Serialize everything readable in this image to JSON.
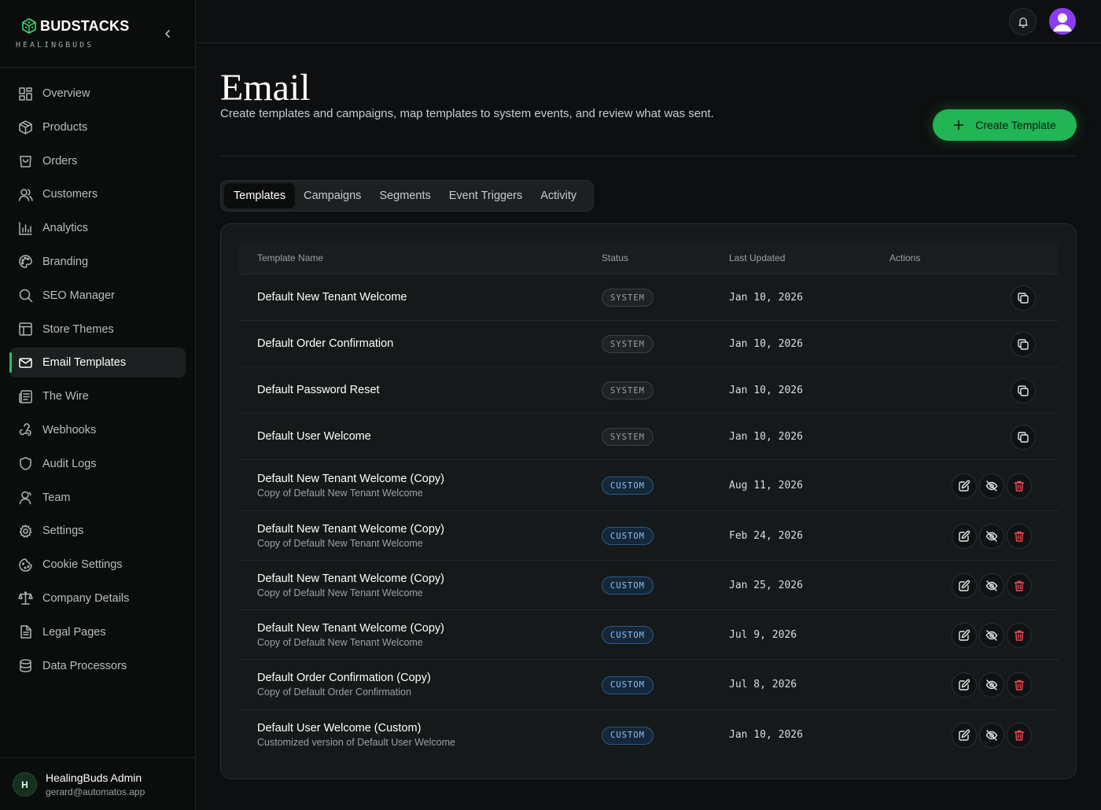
{
  "brand": {
    "name": "BUDSTACKS",
    "tagline": "HEALINGBUDS"
  },
  "sidebar": {
    "items": [
      {
        "label": "Overview",
        "icon": "grid-icon"
      },
      {
        "label": "Products",
        "icon": "box-icon"
      },
      {
        "label": "Orders",
        "icon": "bag-icon"
      },
      {
        "label": "Customers",
        "icon": "users-icon"
      },
      {
        "label": "Analytics",
        "icon": "bar-chart-icon"
      },
      {
        "label": "Branding",
        "icon": "palette-icon"
      },
      {
        "label": "SEO Manager",
        "icon": "search-icon"
      },
      {
        "label": "Store Themes",
        "icon": "layout-icon"
      },
      {
        "label": "Email Templates",
        "icon": "mail-icon",
        "active": true
      },
      {
        "label": "The Wire",
        "icon": "newspaper-icon"
      },
      {
        "label": "Webhooks",
        "icon": "webhook-icon"
      },
      {
        "label": "Audit Logs",
        "icon": "shield-icon"
      },
      {
        "label": "Team",
        "icon": "user-icon"
      },
      {
        "label": "Settings",
        "icon": "gear-icon"
      },
      {
        "label": "Cookie Settings",
        "icon": "cookie-icon"
      },
      {
        "label": "Company Details",
        "icon": "scale-icon"
      },
      {
        "label": "Legal Pages",
        "icon": "document-icon"
      },
      {
        "label": "Data Processors",
        "icon": "database-icon"
      }
    ]
  },
  "user": {
    "initial": "H",
    "name": "HealingBuds Admin",
    "email": "gerard@automatos.app"
  },
  "page": {
    "title": "Email",
    "description": "Create templates and campaigns, map templates to system events, and review what was sent.",
    "create_label": "Create Template"
  },
  "tabs": [
    {
      "label": "Templates",
      "active": true
    },
    {
      "label": "Campaigns"
    },
    {
      "label": "Segments"
    },
    {
      "label": "Event Triggers"
    },
    {
      "label": "Activity"
    }
  ],
  "table": {
    "headers": {
      "name": "Template Name",
      "status": "Status",
      "updated": "Last Updated",
      "actions": "Actions"
    },
    "rows": [
      {
        "name": "Default New Tenant Welcome",
        "subtitle": "",
        "status": "SYSTEM",
        "updated": "Jan 10, 2026"
      },
      {
        "name": "Default Order Confirmation",
        "subtitle": "",
        "status": "SYSTEM",
        "updated": "Jan 10, 2026"
      },
      {
        "name": "Default Password Reset",
        "subtitle": "",
        "status": "SYSTEM",
        "updated": "Jan 10, 2026"
      },
      {
        "name": "Default User Welcome",
        "subtitle": "",
        "status": "SYSTEM",
        "updated": "Jan 10, 2026"
      },
      {
        "name": "Default New Tenant Welcome (Copy)",
        "subtitle": "Copy of Default New Tenant Welcome",
        "status": "CUSTOM",
        "updated": "Aug 11, 2026"
      },
      {
        "name": "Default New Tenant Welcome (Copy)",
        "subtitle": "Copy of Default New Tenant Welcome",
        "status": "CUSTOM",
        "updated": "Feb 24, 2026"
      },
      {
        "name": "Default New Tenant Welcome (Copy)",
        "subtitle": "Copy of Default New Tenant Welcome",
        "status": "CUSTOM",
        "updated": "Jan 25, 2026"
      },
      {
        "name": "Default New Tenant Welcome (Copy)",
        "subtitle": "Copy of Default New Tenant Welcome",
        "status": "CUSTOM",
        "updated": "Jul 9, 2026"
      },
      {
        "name": "Default Order Confirmation (Copy)",
        "subtitle": "Copy of Default Order Confirmation",
        "status": "CUSTOM",
        "updated": "Jul 8, 2026"
      },
      {
        "name": "Default User Welcome (Custom)",
        "subtitle": "Customized version of Default User Welcome",
        "status": "CUSTOM",
        "updated": "Jan 10, 2026"
      }
    ]
  },
  "colors": {
    "accent": "#22b455",
    "danger": "#f0484e",
    "avatar": "#8b3cf0"
  }
}
